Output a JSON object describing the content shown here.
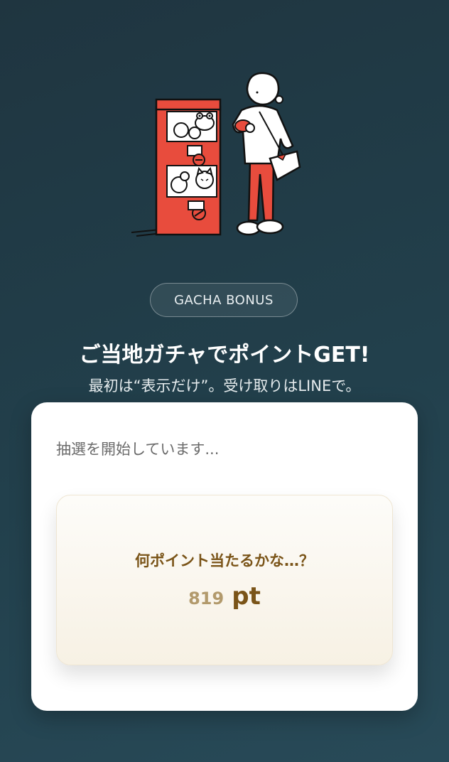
{
  "badge": {
    "label": "GACHA BONUS"
  },
  "title": "ご当地ガチャでポイントGET!",
  "subtitle": "最初は“表示だけ”。受け取りはLINEで。",
  "card": {
    "status": "抽選を開始しています...",
    "question": "何ポイント当たるかな…？",
    "points_value": "819",
    "points_unit": "pt"
  },
  "colors": {
    "background": "#22404c",
    "accent_red": "#e84c3d",
    "brown_text": "#7a5418",
    "muted_gold": "#b29a6c"
  },
  "illustration": {
    "icons": [
      "gacha-machine-icon",
      "person-icon",
      "frog-capsule-icon",
      "cat-capsule-icon"
    ]
  }
}
